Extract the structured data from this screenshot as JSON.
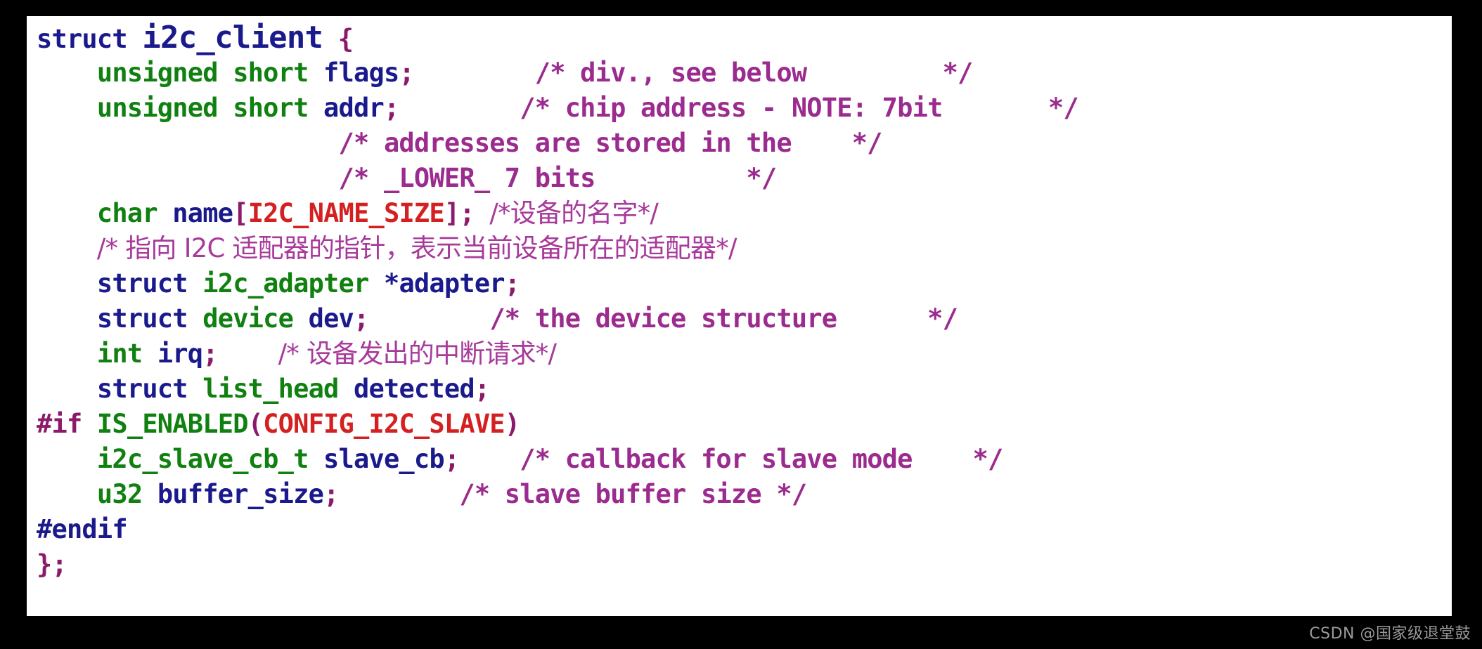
{
  "image": {
    "background_color": "#000000",
    "panel_color": "#ffffff",
    "kind": "code-screenshot"
  },
  "palette": {
    "keyword": "#1a1a8c",
    "type": "#108010",
    "identifier": "#1a1a8c",
    "punctuation": "#8b1a6b",
    "comment": "#9b2b8e",
    "comment_cn": "#a83a9b",
    "macro": "#d42020",
    "preprocessor": "#8b1a6b",
    "function": "#108010",
    "watermark": "#9a9a9a"
  },
  "code": {
    "language": "c",
    "title": "struct i2c_client",
    "lines": [
      {
        "n": 1,
        "text": "struct i2c_client {",
        "tokens": [
          {
            "t": "struct ",
            "c": "keyword"
          },
          {
            "t": "i2c_client",
            "c": "keyword",
            "big": true
          },
          {
            "t": " ",
            "c": "plain"
          },
          {
            "t": "{",
            "c": "punctuation"
          }
        ]
      },
      {
        "n": 2,
        "text": "    unsigned short flags;          /* div., see below          */",
        "tokens": [
          {
            "t": "    ",
            "c": "plain"
          },
          {
            "t": "unsigned short ",
            "c": "type"
          },
          {
            "t": "flags",
            "c": "identifier"
          },
          {
            "t": ";",
            "c": "punctuation"
          },
          {
            "t": "        ",
            "c": "plain"
          },
          {
            "t": "/* div., see below         */",
            "c": "comment"
          }
        ]
      },
      {
        "n": 3,
        "text": "    unsigned short addr;           /* chip address - NOTE: 7bit       */",
        "tokens": [
          {
            "t": "    ",
            "c": "plain"
          },
          {
            "t": "unsigned short ",
            "c": "type"
          },
          {
            "t": "addr",
            "c": "identifier"
          },
          {
            "t": ";",
            "c": "punctuation"
          },
          {
            "t": "        ",
            "c": "plain"
          },
          {
            "t": "/* chip address - NOTE: 7bit       */",
            "c": "comment"
          }
        ]
      },
      {
        "n": 4,
        "text": "                   /* addresses are stored in the    */",
        "tokens": [
          {
            "t": "                    ",
            "c": "plain"
          },
          {
            "t": "/* addresses are stored in the    */",
            "c": "comment"
          }
        ]
      },
      {
        "n": 5,
        "text": "                   /* _LOWER_ 7 bits           */",
        "tokens": [
          {
            "t": "                    ",
            "c": "plain"
          },
          {
            "t": "/* _LOWER_ 7 bits          */",
            "c": "comment"
          }
        ]
      },
      {
        "n": 6,
        "text": "    char name[I2C_NAME_SIZE]; /*设备的名字*/",
        "tokens": [
          {
            "t": "    ",
            "c": "plain"
          },
          {
            "t": "char ",
            "c": "type"
          },
          {
            "t": "name",
            "c": "identifier"
          },
          {
            "t": "[",
            "c": "punctuation"
          },
          {
            "t": "I2C_NAME_SIZE",
            "c": "macro"
          },
          {
            "t": "]",
            "c": "punctuation"
          },
          {
            "t": ";",
            "c": "punctuation"
          },
          {
            "t": " ",
            "c": "plain"
          },
          {
            "t": "/*设备的名字*/",
            "c": "comment_cn"
          }
        ]
      },
      {
        "n": 7,
        "text": "    /* 指向 I2C 适配器的指针，表示当前设备所在的适配器*/",
        "tokens": [
          {
            "t": "    ",
            "c": "plain"
          },
          {
            "t": "/* 指向 I2C 适配器的指针，表示当前设备所在的适配器*/",
            "c": "comment_cn"
          }
        ]
      },
      {
        "n": 8,
        "text": "    struct i2c_adapter *adapter;",
        "tokens": [
          {
            "t": "    ",
            "c": "plain"
          },
          {
            "t": "struct ",
            "c": "keyword"
          },
          {
            "t": "i2c_adapter ",
            "c": "type"
          },
          {
            "t": "*adapter",
            "c": "identifier"
          },
          {
            "t": ";",
            "c": "punctuation"
          }
        ]
      },
      {
        "n": 9,
        "text": "    struct device dev;        /* the device structure      */",
        "tokens": [
          {
            "t": "    ",
            "c": "plain"
          },
          {
            "t": "struct ",
            "c": "keyword"
          },
          {
            "t": "device ",
            "c": "type"
          },
          {
            "t": "dev",
            "c": "identifier"
          },
          {
            "t": ";",
            "c": "punctuation"
          },
          {
            "t": "        ",
            "c": "plain"
          },
          {
            "t": "/* the device structure      */",
            "c": "comment"
          }
        ]
      },
      {
        "n": 10,
        "text": "    int irq;    /* 设备发出的中断请求*/",
        "tokens": [
          {
            "t": "    ",
            "c": "plain"
          },
          {
            "t": "int ",
            "c": "type"
          },
          {
            "t": "irq",
            "c": "identifier"
          },
          {
            "t": ";",
            "c": "punctuation"
          },
          {
            "t": "    ",
            "c": "plain"
          },
          {
            "t": "/* 设备发出的中断请求*/",
            "c": "comment_cn"
          }
        ]
      },
      {
        "n": 11,
        "text": "    struct list_head detected;",
        "tokens": [
          {
            "t": "    ",
            "c": "plain"
          },
          {
            "t": "struct ",
            "c": "keyword"
          },
          {
            "t": "list_head ",
            "c": "type"
          },
          {
            "t": "detected",
            "c": "identifier"
          },
          {
            "t": ";",
            "c": "punctuation"
          }
        ]
      },
      {
        "n": 12,
        "text": "#if IS_ENABLED(CONFIG_I2C_SLAVE)",
        "tokens": [
          {
            "t": "#if ",
            "c": "preprocessor"
          },
          {
            "t": "IS_ENABLED",
            "c": "function"
          },
          {
            "t": "(",
            "c": "punctuation"
          },
          {
            "t": "CONFIG_I2C_SLAVE",
            "c": "macro"
          },
          {
            "t": ")",
            "c": "punctuation"
          }
        ]
      },
      {
        "n": 13,
        "text": "    i2c_slave_cb_t slave_cb;    /* callback for slave mode    */",
        "tokens": [
          {
            "t": "    ",
            "c": "plain"
          },
          {
            "t": "i2c_slave_cb_t ",
            "c": "type"
          },
          {
            "t": "slave_cb",
            "c": "identifier"
          },
          {
            "t": ";",
            "c": "punctuation"
          },
          {
            "t": "    ",
            "c": "plain"
          },
          {
            "t": "/* callback for slave mode    */",
            "c": "comment"
          }
        ]
      },
      {
        "n": 14,
        "text": "    u32 buffer_size;         /* slave buffer size */",
        "tokens": [
          {
            "t": "    ",
            "c": "plain"
          },
          {
            "t": "u32 ",
            "c": "type"
          },
          {
            "t": "buffer_size",
            "c": "identifier"
          },
          {
            "t": ";",
            "c": "punctuation"
          },
          {
            "t": "        ",
            "c": "plain"
          },
          {
            "t": "/* slave buffer size */",
            "c": "comment"
          }
        ]
      },
      {
        "n": 15,
        "text": "#endif",
        "tokens": [
          {
            "t": "#endif",
            "c": "keyword"
          }
        ]
      },
      {
        "n": 16,
        "text": "};",
        "tokens": [
          {
            "t": "}",
            "c": "punctuation"
          },
          {
            "t": ";",
            "c": "punctuation"
          }
        ]
      }
    ]
  },
  "watermark": {
    "text": "CSDN @国家级退堂鼓",
    "site": "CSDN",
    "author": "@国家级退堂鼓"
  }
}
